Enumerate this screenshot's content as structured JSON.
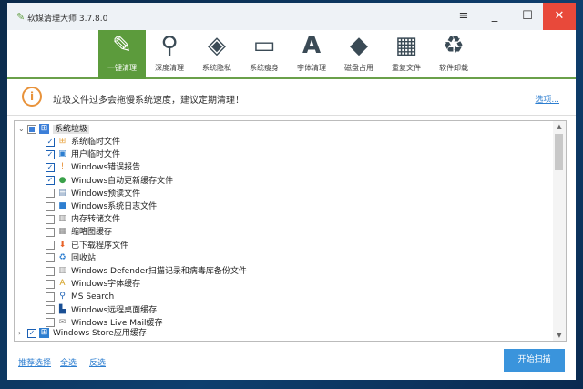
{
  "window": {
    "title": "软媒清理大师 3.7.8.0"
  },
  "titlebar": {
    "menu": "≡",
    "minimize": "_",
    "maximize": "☐",
    "close": "✕"
  },
  "tabs": [
    {
      "label": "一键清理",
      "icon": "broom-icon",
      "glyph": "✎",
      "active": true
    },
    {
      "label": "深度清理",
      "icon": "magnifier-icon",
      "glyph": "⚲"
    },
    {
      "label": "系统隐私",
      "icon": "eraser-icon",
      "glyph": "◈"
    },
    {
      "label": "系统瘦身",
      "icon": "monitor-icon",
      "glyph": "▭"
    },
    {
      "label": "字体清理",
      "icon": "font-icon",
      "glyph": "A"
    },
    {
      "label": "磁盘占用",
      "icon": "disk-icon",
      "glyph": "◆"
    },
    {
      "label": "重复文件",
      "icon": "grid-icon",
      "glyph": "▦"
    },
    {
      "label": "软件卸载",
      "icon": "recycle-icon",
      "glyph": "♻"
    }
  ],
  "info": {
    "text": "垃圾文件过多会拖慢系统速度，建议定期清理！",
    "options_link": "选项..."
  },
  "tree": {
    "root": {
      "label": "系统垃圾",
      "state": "partial"
    },
    "items": [
      {
        "label": "系统临时文件",
        "checked": true,
        "icon": "windows-icon",
        "glyph": "⊞",
        "color": "#e8a13a"
      },
      {
        "label": "用户临时文件",
        "checked": true,
        "icon": "users-icon",
        "glyph": "▣",
        "color": "#2d7ed0"
      },
      {
        "label": "Windows错误报告",
        "checked": true,
        "icon": "warning-icon",
        "glyph": "!",
        "color": "#e8923a"
      },
      {
        "label": "Windows自动更新缓存文件",
        "checked": true,
        "icon": "globe-icon",
        "glyph": "●",
        "color": "#3aa14a"
      },
      {
        "label": "Windows预读文件",
        "checked": false,
        "icon": "prefetch-icon",
        "glyph": "▤",
        "color": "#6a8ab0"
      },
      {
        "label": "Windows系统日志文件",
        "checked": false,
        "icon": "log-icon",
        "glyph": "■",
        "color": "#2d7ed0"
      },
      {
        "label": "内存转储文件",
        "checked": false,
        "icon": "memory-icon",
        "glyph": "▥",
        "color": "#888"
      },
      {
        "label": "缩略图缓存",
        "checked": false,
        "icon": "thumbnail-icon",
        "glyph": "▦",
        "color": "#888"
      },
      {
        "label": "已下载程序文件",
        "checked": false,
        "icon": "download-icon",
        "glyph": "⬇",
        "color": "#e8632a"
      },
      {
        "label": "回收站",
        "checked": false,
        "icon": "recycle-bin-icon",
        "glyph": "♻",
        "color": "#2d7ed0"
      },
      {
        "label": "Windows Defender扫描记录和病毒库备份文件",
        "checked": false,
        "icon": "defender-icon",
        "glyph": "▥",
        "color": "#999"
      },
      {
        "label": "Windows字体缓存",
        "checked": false,
        "icon": "font-cache-icon",
        "glyph": "A",
        "color": "#d4a020"
      },
      {
        "label": "MS Search",
        "checked": false,
        "icon": "search-icon",
        "glyph": "⚲",
        "color": "#1a5fb4"
      },
      {
        "label": "Windows远程桌面缓存",
        "checked": false,
        "icon": "remote-desktop-icon",
        "glyph": "▙",
        "color": "#1a4f94"
      },
      {
        "label": "Windows Live Mail缓存",
        "checked": false,
        "icon": "mail-icon",
        "glyph": "✉",
        "color": "#888"
      }
    ],
    "store": {
      "label": "Windows Store应用缓存",
      "checked": true
    }
  },
  "footer": {
    "recommended": "推荐选择",
    "select_all": "全选",
    "invert": "反选",
    "scan": "开始扫描"
  }
}
